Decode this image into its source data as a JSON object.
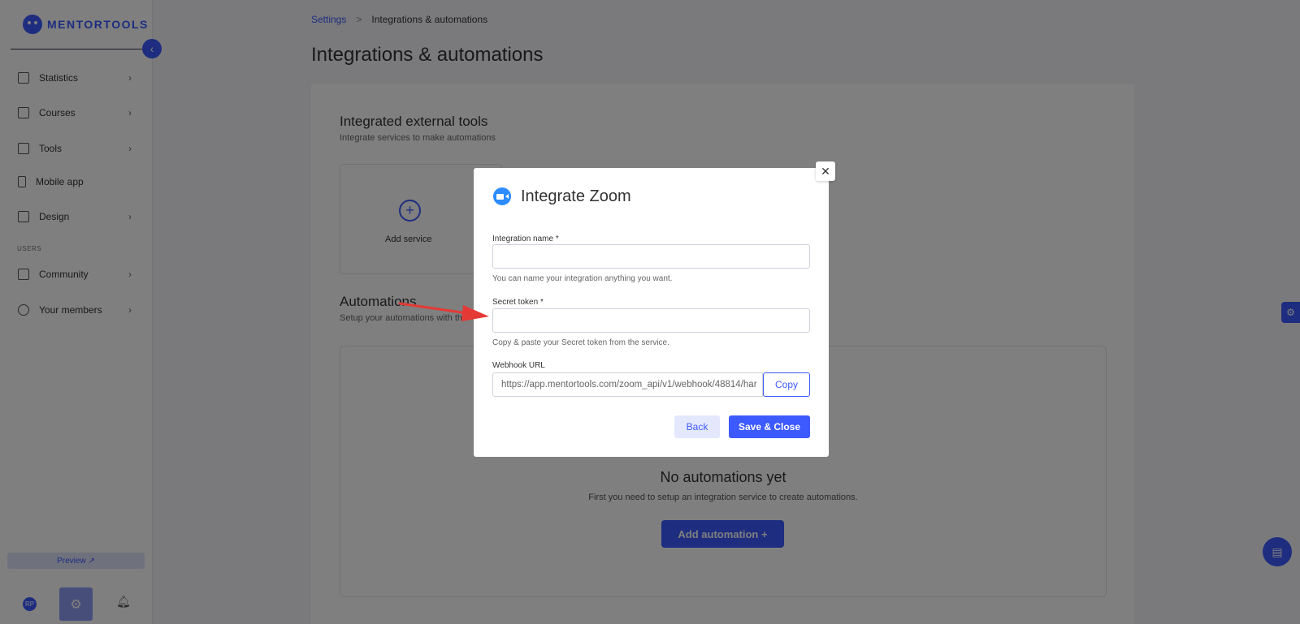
{
  "app": {
    "logo_text": "MENTORTOOLS"
  },
  "sidebar": {
    "items": [
      {
        "label": "Statistics",
        "icon": "bar-chart-icon",
        "has_chevron": true
      },
      {
        "label": "Courses",
        "icon": "book-icon",
        "has_chevron": true
      },
      {
        "label": "Tools",
        "icon": "megaphone-icon",
        "has_chevron": true
      },
      {
        "label": "Mobile app",
        "icon": "phone-icon",
        "has_chevron": false
      },
      {
        "label": "Design",
        "icon": "pencil-icon",
        "has_chevron": true
      },
      {
        "label": "Community",
        "icon": "community-icon",
        "has_chevron": true
      },
      {
        "label": "Your members",
        "icon": "user-icon",
        "has_chevron": true
      }
    ],
    "section_users": "USERS",
    "preview_label": "Preview ↗",
    "avatar_initials": "RP"
  },
  "breadcrumb": {
    "root": "Settings",
    "sep": ">",
    "current": "Integrations & automations"
  },
  "page": {
    "title": "Integrations & automations",
    "integrations_title": "Integrated external tools",
    "integrations_sub": "Integrate services to make automations",
    "add_service": "Add service",
    "automations_title": "Automations",
    "automations_sub": "Setup your automations with th",
    "empty_title": "No automations yet",
    "empty_sub": "First you need to setup an integration service to create automations.",
    "add_automation": "Add automation  +"
  },
  "modal": {
    "title": "Integrate Zoom",
    "name_label": "Integration name",
    "name_value": "",
    "name_hint": "You can name your integration anything you want.",
    "token_label": "Secret token",
    "token_value": "",
    "token_hint": "Copy & paste your Secret token from the service.",
    "required_mark": "*",
    "webhook_label": "Webhook URL",
    "webhook_value": "https://app.mentortools.com/zoom_api/v1/webhook/48814/har",
    "copy_label": "Copy",
    "back_label": "Back",
    "save_label": "Save & Close",
    "close_glyph": "✕"
  },
  "colors": {
    "accent": "#3d5afe",
    "zoom": "#2d8cff",
    "arrow": "#e53935"
  }
}
